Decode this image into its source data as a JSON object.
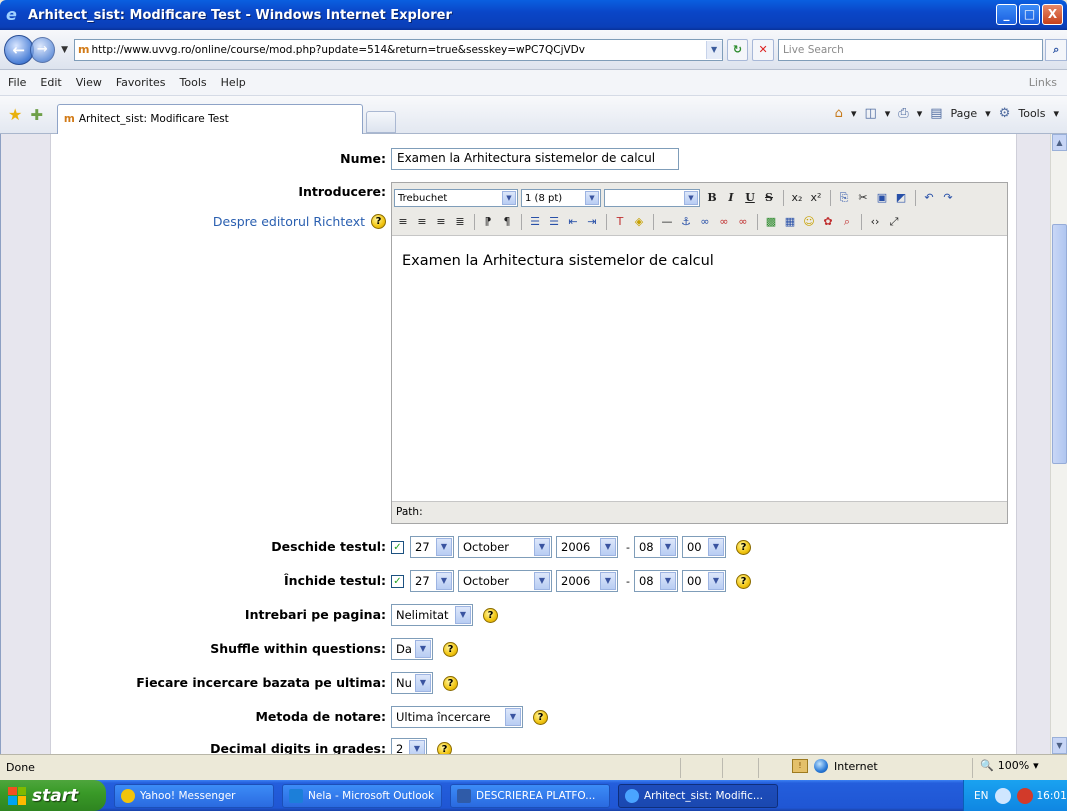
{
  "window": {
    "title": "Arhitect_sist: Modificare Test - Windows Internet Explorer",
    "buttons": {
      "minimize": "_",
      "maximize": "□",
      "close": "X"
    }
  },
  "address_bar": {
    "url": "http://www.uvvg.ro/online/course/mod.php?update=514&return=true&sesskey=wPC7QCjVDv",
    "search_placeholder": "Live Search"
  },
  "menu": {
    "items": [
      "File",
      "Edit",
      "View",
      "Favorites",
      "Tools",
      "Help"
    ],
    "links_label": "Links"
  },
  "tabs": {
    "active_tab": "Arhitect_sist: Modificare Test"
  },
  "commands": {
    "page": "Page",
    "tools": "Tools"
  },
  "form": {
    "name_label": "Nume:",
    "name_value": "Examen la Arhitectura sistemelor de calcul",
    "intro_label": "Introducere:",
    "editor_help_link": "Despre editorul Richtext",
    "editor": {
      "font_family": "Trebuchet",
      "font_size": "1 (8 pt)",
      "paragraph_style": "",
      "content": "Examen la Arhitectura sistemelor de calcul",
      "path_label": "Path:"
    },
    "open_label": "Deschide testul:",
    "open": {
      "day": "27",
      "month": "October",
      "year": "2006",
      "hour": "08",
      "minute": "00"
    },
    "close_label": "Închide testul:",
    "close": {
      "day": "27",
      "month": "October",
      "year": "2006",
      "hour": "08",
      "minute": "00"
    },
    "questions_per_page_label": "Intrebari pe pagina:",
    "questions_per_page_value": "Nelimitat",
    "shuffle_label": "Shuffle within questions:",
    "shuffle_value": "Da",
    "attempt_based_label": "Fiecare incercare bazata pe ultima:",
    "attempt_based_value": "Nu",
    "grading_method_label": "Metoda de notare:",
    "grading_method_value": "Ultima încercare",
    "decimal_digits_label": "Decimal digits in grades:",
    "decimal_digits_value": "2"
  },
  "status_bar": {
    "status": "Done",
    "zone": "Internet",
    "zoom": "100%"
  },
  "taskbar": {
    "start_label": "start",
    "items": [
      {
        "label": "Yahoo! Messenger",
        "color": "#f2c40a"
      },
      {
        "label": "Nela - Microsoft Outlook",
        "color": "#1c7fd9"
      },
      {
        "label": "DESCRIEREA PLATFO...",
        "color": "#2f5ba8"
      },
      {
        "label": "Arhitect_sist: Modific...",
        "color": "#4aa4ff"
      }
    ],
    "tray_lang": "EN",
    "clock": "16:01"
  }
}
